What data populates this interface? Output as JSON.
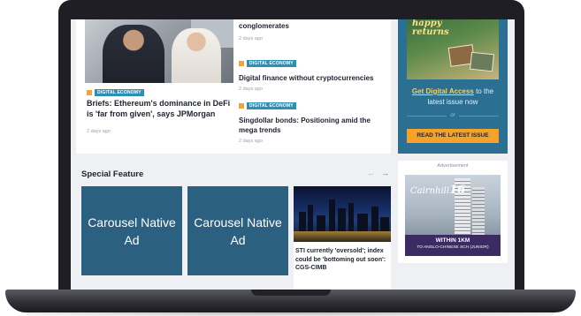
{
  "top_stories": {
    "side_first_title_tail": "conglomerates",
    "side_first_date": "2 days ago",
    "hero": {
      "tag": "DIGITAL ECONOMY",
      "title": "Briefs: Ethereum's dominance in DeFi is 'far from given', says JPMorgan",
      "date": "2 days ago"
    },
    "side_items": [
      {
        "tag": "DIGITAL ECONOMY",
        "title": "Digital finance without cryptocurrencies",
        "date": "2 days ago"
      },
      {
        "tag": "DIGITAL ECONOMY",
        "title": "Singdollar bonds: Positioning amid the mega trends",
        "date": "2 days ago"
      }
    ]
  },
  "promo": {
    "magazine_title_line1": "happy",
    "magazine_title_line2": "returns",
    "link": "Get Digital Access",
    "text_suffix": "to the latest issue now",
    "or": "or",
    "button": "READ THE LATEST ISSUE",
    "bg_color": "#2b6f93",
    "button_color": "#f4a22a"
  },
  "special_feature": {
    "title": "Special Feature",
    "prev_icon": "←",
    "next_icon": "→",
    "ad_label_1": "Carousel Native Ad",
    "ad_label_2": "Carousel Native Ad",
    "feature_title": "STI currently 'oversold'; index could be 'bottoming out soon': CGS-CIMB"
  },
  "advertisement": {
    "label": "Advertisement",
    "brand_name": "Cairnhill",
    "brand_number": "16",
    "line1": "WITHIN 1KM",
    "line2": "TO ANGLO-CHINESE SCH (JUNIOR)"
  }
}
